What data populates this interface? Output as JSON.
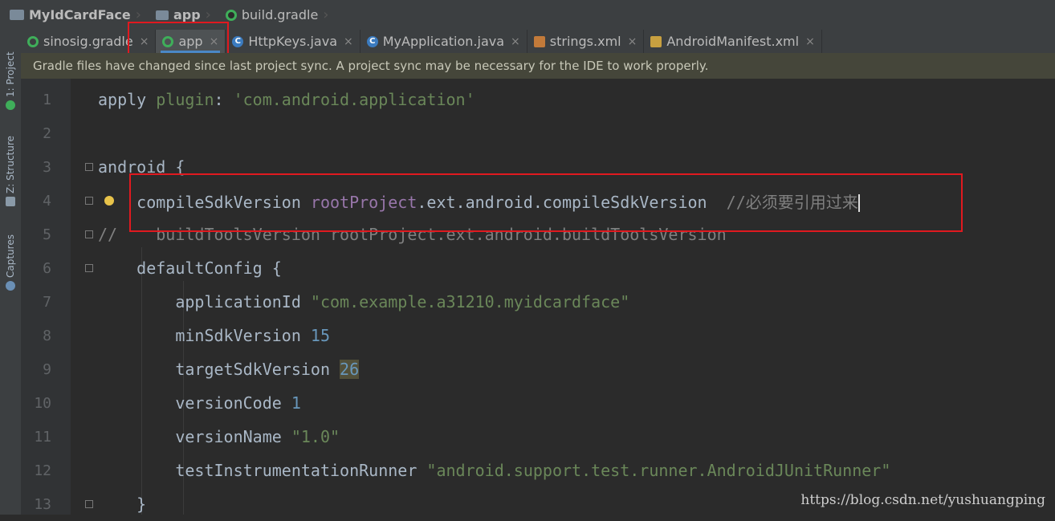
{
  "breadcrumb": [
    {
      "label": "MyIdCardFace",
      "icon": "project-folder-icon"
    },
    {
      "label": "app",
      "icon": "module-folder-icon"
    },
    {
      "label": "build.gradle",
      "icon": "gradle-icon"
    }
  ],
  "sidebar": [
    {
      "label": "1: Project",
      "icon": "project-icon"
    },
    {
      "label": "Z: Structure",
      "icon": "structure-icon"
    },
    {
      "label": "Captures",
      "icon": "captures-icon"
    }
  ],
  "tabs": [
    {
      "label": "sinosig.gradle",
      "icon": "gradle",
      "active": false
    },
    {
      "label": "app",
      "icon": "gradle",
      "active": true
    },
    {
      "label": "HttpKeys.java",
      "icon": "java",
      "active": false
    },
    {
      "label": "MyApplication.java",
      "icon": "java",
      "active": false
    },
    {
      "label": "strings.xml",
      "icon": "xml",
      "active": false
    },
    {
      "label": "AndroidManifest.xml",
      "icon": "manifest",
      "active": false
    }
  ],
  "close_glyph": "×",
  "notice": "Gradle files have changed since last project sync. A project sync may be necessary for the IDE to work properly.",
  "editor": {
    "lines": [
      {
        "n": "1",
        "code": "apply plugin: 'com.android.application'"
      },
      {
        "n": "2",
        "code": ""
      },
      {
        "n": "3",
        "code": "android {"
      },
      {
        "n": "4",
        "code": "    compileSdkVersion rootProject.ext.android.compileSdkVersion  //必须要引用过来"
      },
      {
        "n": "5",
        "code": "//    buildToolsVersion rootProject.ext.android.buildToolsVersion"
      },
      {
        "n": "6",
        "code": "    defaultConfig {"
      },
      {
        "n": "7",
        "code": "        applicationId \"com.example.a31210.myidcardface\""
      },
      {
        "n": "8",
        "code": "        minSdkVersion 15"
      },
      {
        "n": "9",
        "code": "        targetSdkVersion 26"
      },
      {
        "n": "10",
        "code": "        versionCode 1"
      },
      {
        "n": "11",
        "code": "        versionName \"1.0\""
      },
      {
        "n": "12",
        "code": "        testInstrumentationRunner \"android.support.test.runner.AndroidJUnitRunner\""
      },
      {
        "n": "13",
        "code": "    }"
      }
    ]
  },
  "watermark": "https://blog.csdn.net/yushuangping",
  "colors": {
    "red_annotation": "#e0191f",
    "active_tab_underline": "#4a88c7",
    "gradle_green": "#3fae5a"
  }
}
